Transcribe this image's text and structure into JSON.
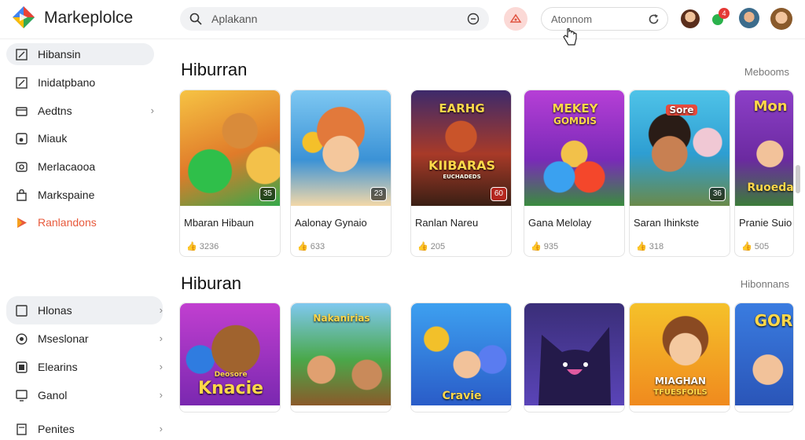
{
  "app": {
    "name": "Markeplolce"
  },
  "search": {
    "placeholder": "Aplakann",
    "icon": "search-icon",
    "clear_icon": "clear-icon"
  },
  "field2": {
    "text": "Atonnom",
    "icon": "refresh-icon"
  },
  "header": {
    "notification_badge": "4"
  },
  "sidebar": {
    "items": [
      {
        "label": "Hibansin",
        "icon": "edit-icon"
      },
      {
        "label": "Inidatpbano",
        "icon": "edit-icon"
      },
      {
        "label": "Aedtns",
        "icon": "card-icon"
      },
      {
        "label": "Miauk",
        "icon": "music-icon"
      },
      {
        "label": "Merlacaooa",
        "icon": "camera-icon"
      },
      {
        "label": "Markspaine",
        "icon": "bag-icon"
      },
      {
        "label": "Ranlandons",
        "icon": "play-icon",
        "color": "#e85a3c"
      }
    ],
    "group2": [
      {
        "label": "Hlonas",
        "icon": "image-icon"
      },
      {
        "label": "Mseslonar",
        "icon": "circle-icon"
      },
      {
        "label": "Elearins",
        "icon": "square-icon"
      },
      {
        "label": "Ganol",
        "icon": "monitor-icon"
      },
      {
        "label": "Penites",
        "icon": "doc-icon"
      }
    ]
  },
  "sections": [
    {
      "title": "Hiburran",
      "link": "Mebooms",
      "cards": [
        {
          "title": "Mbaran Hibaun",
          "rating": "3236",
          "badge": "35",
          "bg": "#f5a623"
        },
        {
          "title": "Aalonay Gynaio",
          "rating": "633",
          "badge": "23",
          "bg": "#3aa0e8"
        },
        {
          "title": "Ranlan Nareu",
          "rating": "205",
          "badge": "60",
          "bg": "#b0402a",
          "thumb_text1": "EARHG",
          "thumb_text2": "KIIBARAS",
          "thumb_text3": "EUCHADEDS"
        },
        {
          "title": "Gana Melolay",
          "rating": "935",
          "badge": "",
          "bg": "#a43fbf",
          "thumb_text1": "MEKEY",
          "thumb_text2": "GOMDIS",
          "thumb_text3": ""
        },
        {
          "title": "Saran Ihinkste",
          "rating": "318",
          "badge": "36",
          "bg": "#2bb5d6",
          "thumb_text1": "Sore",
          "thumb_text2": "",
          "thumb_text3": ""
        },
        {
          "title": "Pranie Suio",
          "rating": "505",
          "badge": "",
          "bg": "#9b3fbf",
          "thumb_text1": "Mon",
          "thumb_text2": "Ruoeda",
          "thumb_text3": ""
        }
      ]
    },
    {
      "title": "Hiburan",
      "link": "Hibonnans",
      "cards": [
        {
          "bg": "#a43ec8",
          "thumb_text1": "Deosore",
          "thumb_text2": "Knacie"
        },
        {
          "bg": "#2f9b3a",
          "thumb_text1": "Nakanirias",
          "thumb_text2": ""
        },
        {
          "bg": "#2a6fd6",
          "thumb_text1": "",
          "thumb_text2": "Cravie"
        },
        {
          "bg": "#4b3fa8",
          "thumb_text1": "",
          "thumb_text2": ""
        },
        {
          "bg": "#f3b51b",
          "thumb_text1": "MIAGHAN",
          "thumb_text2": "TFUESFOILS"
        },
        {
          "bg": "#2f6fd0",
          "thumb_text1": "GOR",
          "thumb_text2": ""
        }
      ]
    }
  ]
}
